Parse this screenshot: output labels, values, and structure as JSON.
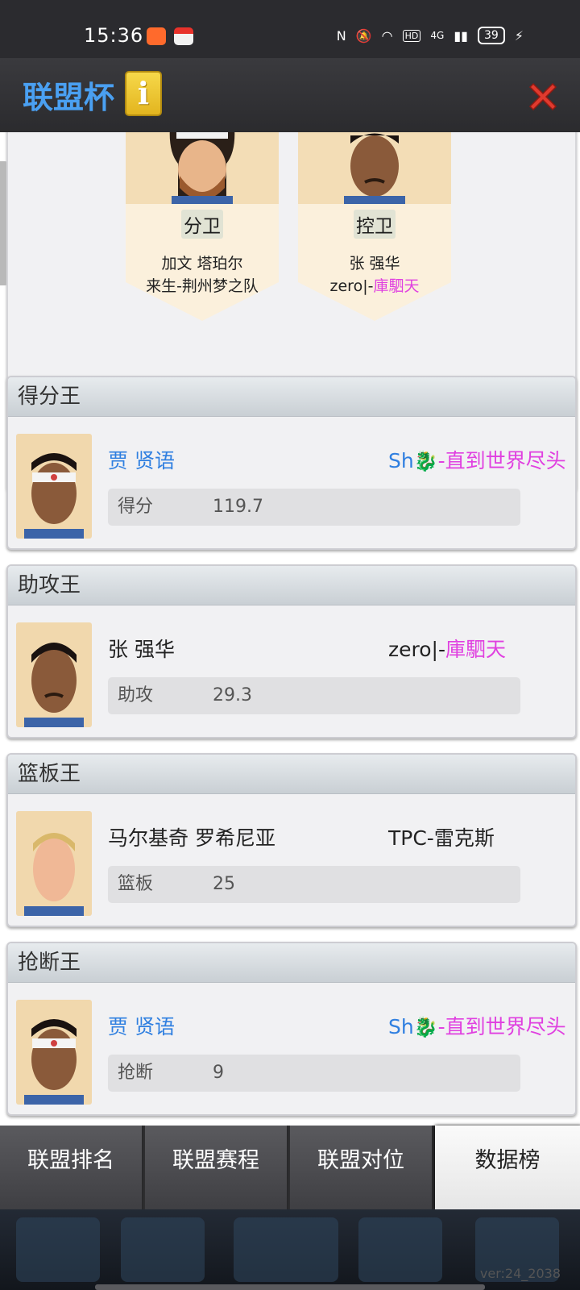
{
  "status_bar": {
    "time": "15:36",
    "network": "4G",
    "hd": "HD",
    "battery": "39"
  },
  "header": {
    "title": "联盟杯",
    "info_icon": "info-icon",
    "close_icon": "close-icon"
  },
  "positions": [
    {
      "position": "分卫",
      "name": "加文 塔珀尔",
      "team_prefix": "来生-荆州梦之队",
      "team_suffix": ""
    },
    {
      "position": "控卫",
      "name": "张 强华",
      "team_prefix": "zero|-",
      "team_suffix": "庫駟天"
    }
  ],
  "leaders": [
    {
      "title": "得分王",
      "player": "贾 贤语",
      "team_prefix": "Sh",
      "team_suffix": "-直到世界尽头",
      "stat_label": "得分",
      "stat_value": "119.7"
    },
    {
      "title": "助攻王",
      "player": "张 强华",
      "team_prefix": "zero|-",
      "team_suffix": "庫駟天",
      "stat_label": "助攻",
      "stat_value": "29.3"
    },
    {
      "title": "篮板王",
      "player": "马尔基奇 罗希尼亚",
      "team_prefix": "TPC-雷克斯",
      "team_suffix": "",
      "stat_label": "篮板",
      "stat_value": "25"
    },
    {
      "title": "抢断王",
      "player": "贾 贤语",
      "team_prefix": "Sh",
      "team_suffix": "-直到世界尽头",
      "stat_label": "抢断",
      "stat_value": "9"
    }
  ],
  "nav": {
    "tabs": [
      "联盟排名",
      "联盟赛程",
      "联盟对位",
      "数据榜"
    ],
    "active": "数据榜"
  },
  "version": "ver:24_2038",
  "colors": {
    "accent_blue": "#4aa0f2",
    "link_blue": "#2f7fe0",
    "magenta": "#e040e0"
  }
}
